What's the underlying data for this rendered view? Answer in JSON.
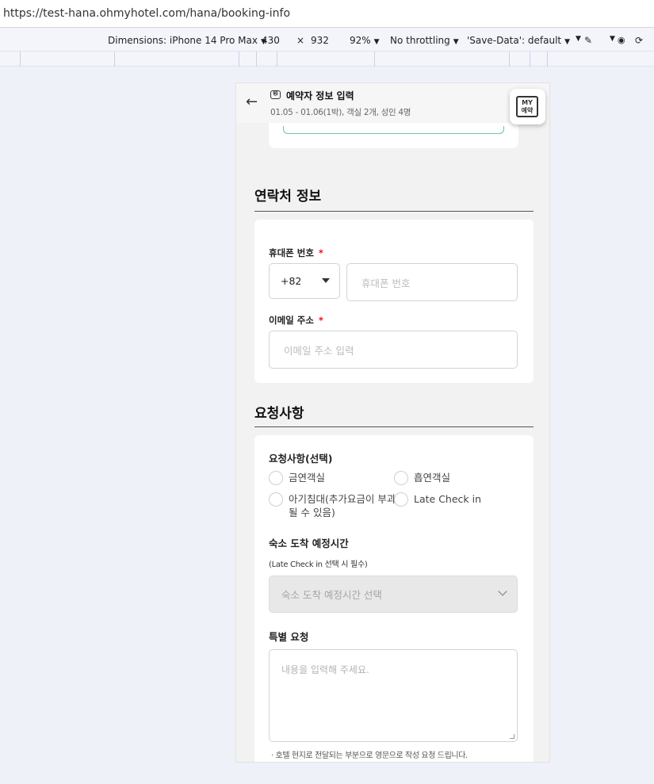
{
  "browser": {
    "url": "https://test-hana.ohmyhotel.com/hana/booking-info"
  },
  "devtools": {
    "dimensions_label": "Dimensions: iPhone 14 Pro Max",
    "width": "430",
    "times": "×",
    "height": "932",
    "zoom": "92%",
    "throttling": "No throttling",
    "save_data": "'Save-Data': default"
  },
  "header": {
    "back_icon": "arrow-left-icon",
    "title_icon": "reservation-icon",
    "title": "예약자 정보 입력",
    "subtitle": "01.05 - 01.06(1박), 객실 2개, 성인 4명",
    "my_button_line1": "MY",
    "my_button_line2": "예약"
  },
  "contact": {
    "section_title": "연락처 정보",
    "phone_label": "휴대폰 번호",
    "required_mark": "*",
    "country_code": "+82",
    "phone_placeholder": "휴대폰 번호",
    "email_label": "이메일 주소",
    "email_placeholder": "이메일 주소 입력"
  },
  "requests": {
    "section_title": "요청사항",
    "options_label": "요청사항(선택)",
    "options": [
      "금연객실",
      "흡연객실",
      "아기침대(추가요금이 부과",
      "Late Check in"
    ],
    "option_continuation": "될 수 있음)",
    "arrival_label": "숙소 도착 예정시간",
    "arrival_note": "(Late Check in 선택 시 필수)",
    "arrival_placeholder": "숙소 도착 예정시간 선택",
    "special_label": "특별 요청",
    "special_placeholder": "내용을 입력해 주세요.",
    "footnote": "· 호텔 현지로 전달되는 부분으로 영문으로 작성 요청 드립니다."
  },
  "colors": {
    "accent_green": "#6ac4a9",
    "required_red": "#e11111",
    "page_bg": "#f2f2f2"
  }
}
